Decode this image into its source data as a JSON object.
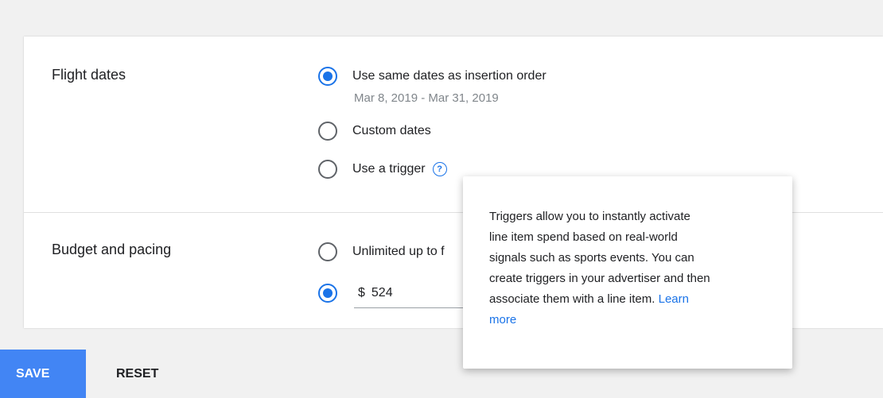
{
  "flight_dates": {
    "label": "Flight dates",
    "options": [
      {
        "label": "Use same dates as insertion order",
        "selected": true
      },
      {
        "label": "Custom dates",
        "selected": false
      },
      {
        "label": "Use a trigger",
        "selected": false
      }
    ],
    "date_range": "Mar 8, 2019 - Mar 31, 2019",
    "help_icon": "?"
  },
  "budget": {
    "label": "Budget and pacing",
    "options": [
      {
        "label": "Unlimited up to f",
        "selected": false
      },
      {
        "label": "",
        "selected": true
      }
    ],
    "currency": "$",
    "value": "524"
  },
  "tooltip": {
    "lines": [
      "Triggers allow you to instantly activate",
      "line item spend based on real-world",
      "signals such as sports events. You can",
      "create triggers in your advertiser and then",
      "associate them with a line item."
    ],
    "link_part1": "Learn",
    "link_part2": "more"
  },
  "footer": {
    "save_label": "SAVE",
    "reset_label": "RESET"
  },
  "colors": {
    "accent": "#1a73e8",
    "save_bg": "#4285f4"
  }
}
